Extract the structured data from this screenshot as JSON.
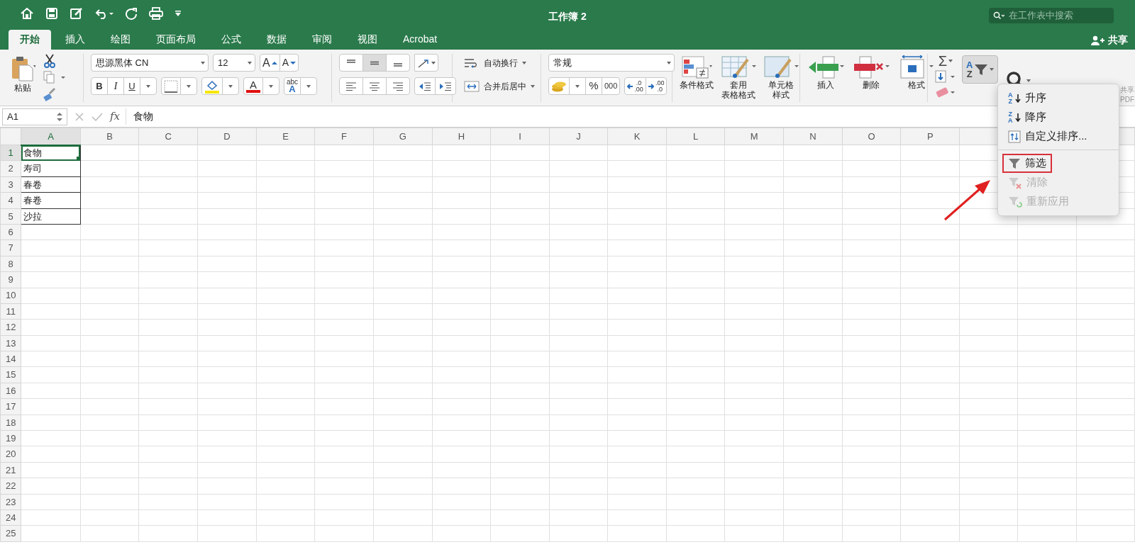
{
  "title_bar": {
    "title": "工作簿 2",
    "search": {
      "placeholder": "在工作表中搜索"
    }
  },
  "tabs": [
    {
      "label": "开始",
      "selected": true
    },
    {
      "label": "插入",
      "selected": false
    },
    {
      "label": "绘图",
      "selected": false
    },
    {
      "label": "页面布局",
      "selected": false
    },
    {
      "label": "公式",
      "selected": false
    },
    {
      "label": "数据",
      "selected": false
    },
    {
      "label": "审阅",
      "selected": false
    },
    {
      "label": "视图",
      "selected": false
    },
    {
      "label": "Acrobat",
      "selected": false
    }
  ],
  "share": {
    "label": "共享"
  },
  "ribbon": {
    "paste": {
      "label": "粘贴"
    },
    "font": {
      "name": "思源黑体 CN",
      "size": "12",
      "grow": "A",
      "shrink": "A",
      "bold": "B",
      "italic": "I",
      "underline": "U",
      "font_color": "A",
      "phonetic": [
        "abc",
        "A"
      ]
    },
    "alignment": {
      "wrap_text": "自动换行",
      "merge_center": "合并后居中"
    },
    "number": {
      "format": "常规",
      "percent": "%",
      "comma": "000",
      "increase_decimal": [
        ".0",
        ".00"
      ],
      "decrease_decimal": [
        ".00",
        ".0"
      ]
    },
    "styles": [
      {
        "lines": [
          "条件格式"
        ]
      },
      {
        "lines": [
          "套用",
          "表格格式"
        ]
      },
      {
        "lines": [
          "单元格",
          "样式"
        ]
      }
    ],
    "cells": [
      {
        "label": "插入"
      },
      {
        "label": "删除"
      },
      {
        "label": "格式"
      }
    ],
    "editing": {
      "sum": "Σ",
      "sort_filter": {
        "letters": [
          "A",
          "Z"
        ],
        "pressed": true
      }
    },
    "pdf": {
      "lines": [
        "共享",
        "PDF"
      ]
    }
  },
  "formula_bar": {
    "name_box": "A1",
    "fx": "fx",
    "content": "食物"
  },
  "sheet": {
    "columns": [
      {
        "label": "A",
        "selected": true
      },
      {
        "label": "B",
        "selected": false
      },
      {
        "label": "C",
        "selected": false
      },
      {
        "label": "D",
        "selected": false
      },
      {
        "label": "E",
        "selected": false
      },
      {
        "label": "F",
        "selected": false
      },
      {
        "label": "G",
        "selected": false
      },
      {
        "label": "H",
        "selected": false
      },
      {
        "label": "I",
        "selected": false
      },
      {
        "label": "J",
        "selected": false
      },
      {
        "label": "K",
        "selected": false
      },
      {
        "label": "L",
        "selected": false
      },
      {
        "label": "M",
        "selected": false
      },
      {
        "label": "N",
        "selected": false
      },
      {
        "label": "O",
        "selected": false
      },
      {
        "label": "P",
        "selected": false
      }
    ],
    "rows": [
      {
        "label": "1",
        "selected": true,
        "cell": {
          "value": "食物",
          "bordered": true,
          "selected": true
        }
      },
      {
        "label": "2",
        "selected": false,
        "cell": {
          "value": "寿司",
          "bordered": true,
          "selected": false
        }
      },
      {
        "label": "3",
        "selected": false,
        "cell": {
          "value": "春卷",
          "bordered": true,
          "selected": false
        }
      },
      {
        "label": "4",
        "selected": false,
        "cell": {
          "value": "春卷",
          "bordered": true,
          "selected": false
        }
      },
      {
        "label": "5",
        "selected": false,
        "cell": {
          "value": "沙拉",
          "bordered": true,
          "selected": false
        }
      },
      {
        "label": "6",
        "selected": false
      },
      {
        "label": "7",
        "selected": false
      },
      {
        "label": "8",
        "selected": false
      },
      {
        "label": "9",
        "selected": false
      },
      {
        "label": "10",
        "selected": false
      },
      {
        "label": "11",
        "selected": false
      },
      {
        "label": "12",
        "selected": false
      },
      {
        "label": "13",
        "selected": false
      },
      {
        "label": "14",
        "selected": false
      },
      {
        "label": "15",
        "selected": false
      },
      {
        "label": "16",
        "selected": false
      },
      {
        "label": "17",
        "selected": false
      },
      {
        "label": "18",
        "selected": false
      },
      {
        "label": "19",
        "selected": false
      },
      {
        "label": "20",
        "selected": false
      },
      {
        "label": "21",
        "selected": false
      },
      {
        "label": "22",
        "selected": false
      },
      {
        "label": "23",
        "selected": false
      },
      {
        "label": "24",
        "selected": false
      },
      {
        "label": "25",
        "selected": false
      }
    ]
  },
  "sort_menu": {
    "items": [
      {
        "kind": "ascending",
        "label": "升序",
        "letters": [
          "A",
          "Z"
        ],
        "disabled": false,
        "highlighted": false
      },
      {
        "kind": "descending",
        "label": "降序",
        "letters": [
          "Z",
          "A"
        ],
        "disabled": false,
        "highlighted": false
      },
      {
        "kind": "custom",
        "label": "自定义排序...",
        "disabled": false,
        "highlighted": false
      },
      {
        "kind": "separator"
      },
      {
        "kind": "filter",
        "label": "筛选",
        "disabled": false,
        "highlighted": true
      },
      {
        "kind": "clear",
        "label": "清除",
        "disabled": true,
        "highlighted": false
      },
      {
        "kind": "reapply",
        "label": "重新应用",
        "disabled": true,
        "highlighted": false
      }
    ]
  }
}
